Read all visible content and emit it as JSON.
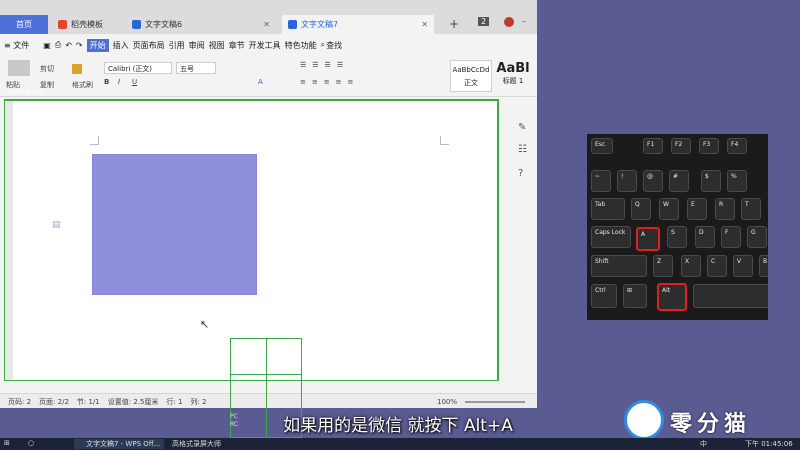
{
  "window": {
    "tabs": [
      {
        "label": "首页"
      },
      {
        "label": "稻壳模板"
      },
      {
        "label": "文字文稿6"
      },
      {
        "label": "文字文稿7"
      }
    ],
    "new_tab": "+",
    "badge": "2"
  },
  "menu": {
    "file": "≡ 文件",
    "items": [
      "开始",
      "插入",
      "页面布局",
      "引用",
      "审阅",
      "视图",
      "章节",
      "开发工具",
      "特色功能"
    ],
    "search": "查找"
  },
  "ribbon": {
    "paste": "粘贴",
    "cut": "剪切",
    "copy": "复制",
    "format_painter": "格式刷",
    "font": "Calibri (正文)",
    "size": "五号",
    "styles": [
      {
        "preview": "AaBbCcDd",
        "name": "正文"
      },
      {
        "preview": "AaBl",
        "name": "标题 1"
      }
    ]
  },
  "capture_size": "1180 x 661",
  "statusbar": {
    "items": [
      "页码: 2",
      "页面: 2/2",
      "节: 1/1",
      "设置值: 2.5厘米",
      "行: 1",
      "列: 2"
    ],
    "zoom": "100%"
  },
  "keyboard": {
    "keys": [
      "Esc",
      "F1",
      "F2",
      "F3",
      "F4",
      "~",
      "!",
      "@",
      "#",
      "$",
      "%",
      "Tab",
      "Q",
      "W",
      "E",
      "R",
      "T",
      "Caps Lock",
      "A",
      "S",
      "D",
      "F",
      "G",
      "Shift",
      "Z",
      "X",
      "C",
      "V",
      "B",
      "Ctrl",
      "Alt"
    ],
    "highlighted": [
      "A",
      "Alt"
    ],
    "highlight_color": "#e02020"
  },
  "subtitle": "如果用的是微信 就按下 Alt+A",
  "logo": {
    "text": "零分猫"
  },
  "taskbar": {
    "items": [
      "文字文稿7 - WPS Off...",
      "高格式录屏大师"
    ],
    "ime": "中",
    "time": "下午 01:45:06"
  },
  "colors": {
    "desktop": "#5b5b94",
    "accent": "#4f6fd9",
    "capture_frame": "#3da94a",
    "shape_fill": "#8f90dc"
  }
}
